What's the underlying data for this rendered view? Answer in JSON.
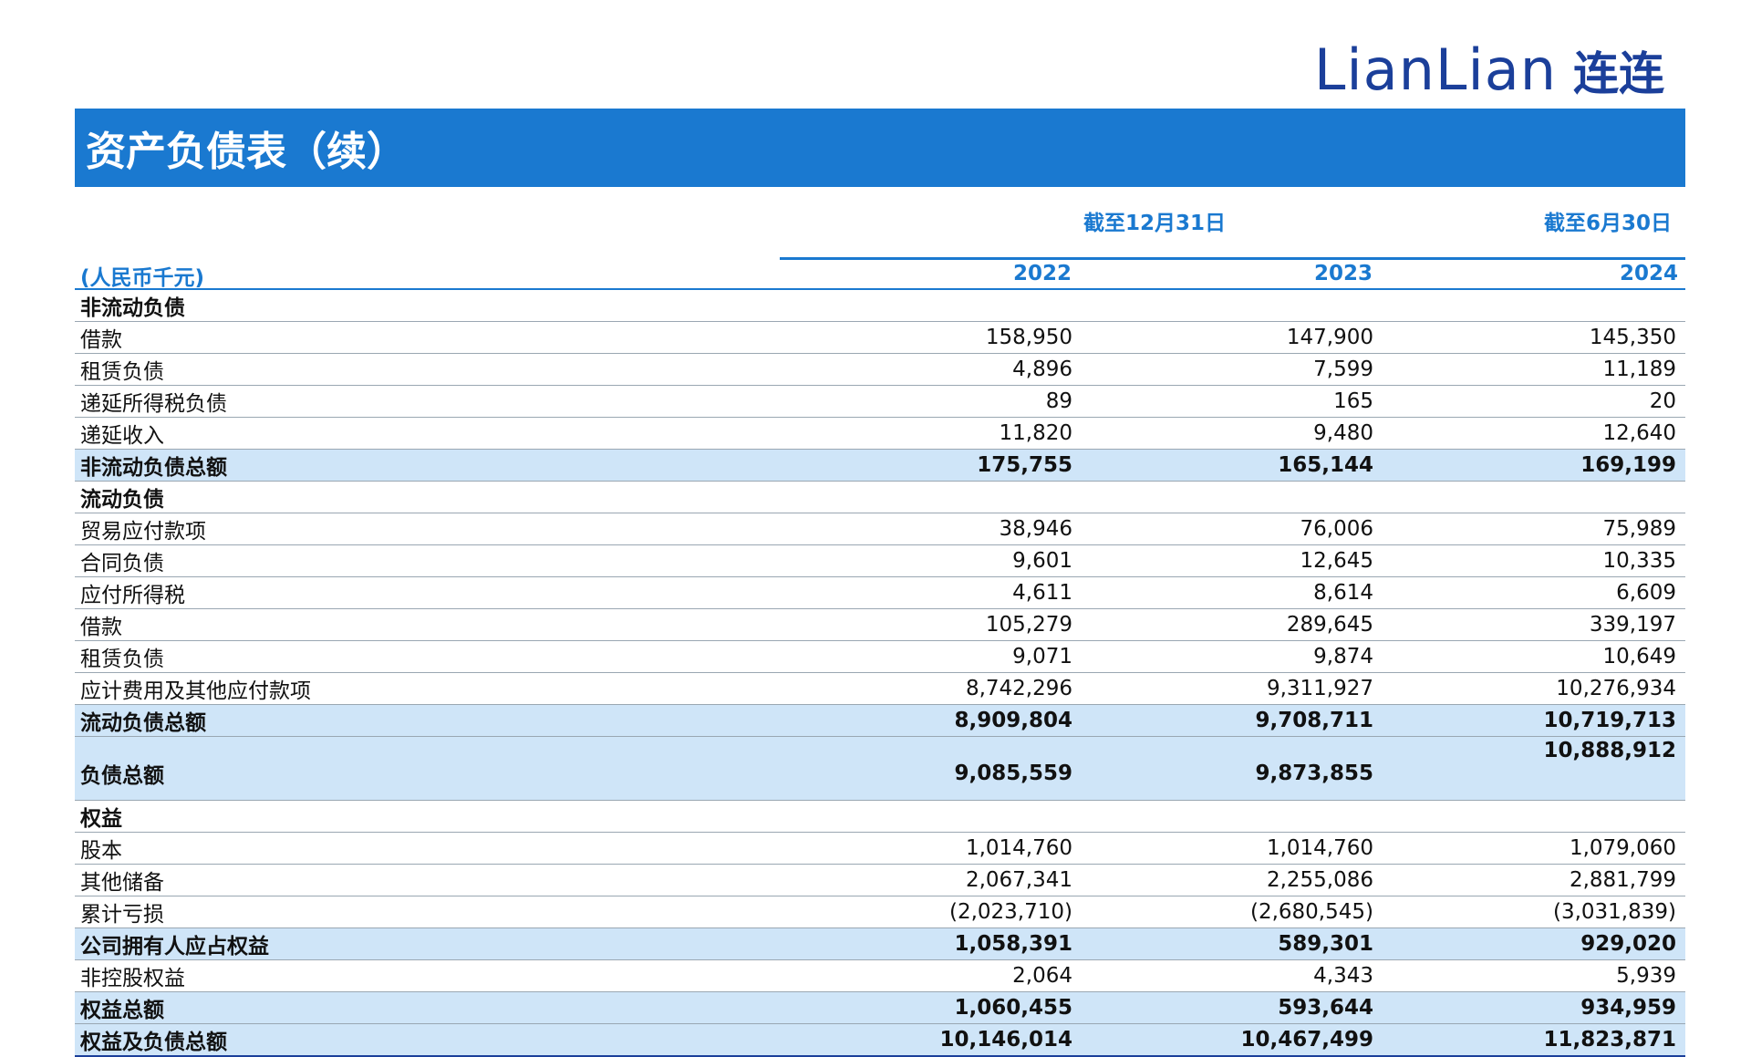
{
  "logo": {
    "latin": "LianLian",
    "cjk": "连连"
  },
  "title": "资产负债表（续）",
  "header": {
    "period_dec": "截至12月31日",
    "period_jun": "截至6月30日",
    "units": "(人民币千元)",
    "years": [
      "2022",
      "2023",
      "2024"
    ]
  },
  "rows": [
    {
      "type": "section",
      "label": "非流动负债",
      "v": [
        "",
        "",
        ""
      ]
    },
    {
      "type": "item",
      "label": "借款",
      "v": [
        "158,950",
        "147,900",
        "145,350"
      ]
    },
    {
      "type": "item",
      "label": "租赁负债",
      "v": [
        "4,896",
        "7,599",
        "11,189"
      ]
    },
    {
      "type": "item",
      "label": "递延所得税负债",
      "v": [
        "89",
        "165",
        "20"
      ]
    },
    {
      "type": "item",
      "label": "递延收入",
      "v": [
        "11,820",
        "9,480",
        "12,640"
      ]
    },
    {
      "type": "total",
      "label": "非流动负债总额",
      "v": [
        "175,755",
        "165,144",
        "169,199"
      ]
    },
    {
      "type": "section",
      "label": "流动负债",
      "v": [
        "",
        "",
        ""
      ]
    },
    {
      "type": "item",
      "label": "贸易应付款项",
      "v": [
        "38,946",
        "76,006",
        "75,989"
      ]
    },
    {
      "type": "item",
      "label": "合同负债",
      "v": [
        "9,601",
        "12,645",
        "10,335"
      ]
    },
    {
      "type": "item",
      "label": "应付所得税",
      "v": [
        "4,611",
        "8,614",
        "6,609"
      ]
    },
    {
      "type": "item",
      "label": "借款",
      "v": [
        "105,279",
        "289,645",
        "339,197"
      ]
    },
    {
      "type": "item",
      "label": "租赁负债",
      "v": [
        "9,071",
        "9,874",
        "10,649"
      ]
    },
    {
      "type": "item",
      "label": "应计费用及其他应付款项",
      "v": [
        "8,742,296",
        "9,311,927",
        "10,276,934"
      ]
    },
    {
      "type": "total",
      "label": "流动负债总额",
      "v": [
        "8,909,804",
        "9,708,711",
        "10,719,713"
      ]
    },
    {
      "type": "total tall",
      "label": "负债总额",
      "v": [
        "9,085,559",
        "9,873,855",
        "10,888,912"
      ]
    },
    {
      "type": "section",
      "label": "权益",
      "v": [
        "",
        "",
        ""
      ]
    },
    {
      "type": "item",
      "label": "股本",
      "v": [
        "1,014,760",
        "1,014,760",
        "1,079,060"
      ]
    },
    {
      "type": "item",
      "label": "其他储备",
      "v": [
        "2,067,341",
        "2,255,086",
        "2,881,799"
      ]
    },
    {
      "type": "item",
      "label": "累计亏损",
      "v": [
        "(2,023,710)",
        "(2,680,545)",
        "(3,031,839)"
      ]
    },
    {
      "type": "total",
      "label": "公司拥有人应占权益",
      "v": [
        "1,058,391",
        "589,301",
        "929,020"
      ]
    },
    {
      "type": "item",
      "label": "非控股权益",
      "v": [
        "2,064",
        "4,343",
        "5,939"
      ]
    },
    {
      "type": "total",
      "label": "权益总额",
      "v": [
        "1,060,455",
        "593,644",
        "934,959"
      ]
    },
    {
      "type": "total last",
      "label": "权益及负债总额",
      "v": [
        "10,146,014",
        "10,467,499",
        "11,823,871"
      ]
    }
  ]
}
